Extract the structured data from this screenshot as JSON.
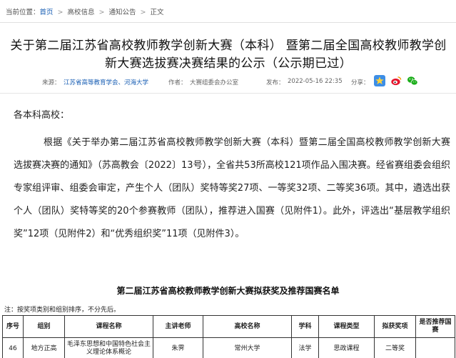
{
  "breadcrumb": {
    "prefix": "当前位置：",
    "items": [
      "首页",
      "高校信息",
      "通知公告",
      "正文"
    ]
  },
  "article": {
    "title": "关于第二届江苏省高校教师教学创新大赛（本科） 暨第二届全国高校教师教学创新大赛选拔赛决赛结果的公示（公示期已过）",
    "meta": {
      "source_label": "来源：",
      "source_value": "江苏省高等教育学会、河海大学",
      "author_label": "作者：",
      "author_value": "大赛组委会办公室",
      "date_label": "发布：",
      "date_value": "2022-05-16 22:35",
      "share_label": "分享："
    },
    "salutation": "各本科高校：",
    "paragraph": "根据《关于举办第二届江苏省高校教师教学创新大赛（本科）暨第二届全国高校教师教学创新大赛选拔赛决赛的通知》（苏高教会〔2022〕13号），全省共53所高校121项作品入围决赛。经省赛组委会组织专家组评审、组委会审定，产生个人（团队）奖特等奖27项、一等奖32项、二等奖36项。其中，遴选出获个人（团队）奖特等奖的20个参赛教师（团队），推荐进入国赛（见附件1）。此外，评选出“基层教学组织奖”12项（见附件2）和“优秀组织奖”11项（见附件3）。"
  },
  "awards_table": {
    "title": "第二届江苏省高校教师教学创新大赛拟获奖及推荐国赛名单",
    "note": "注：按奖项类别和组别排序，不分先后。",
    "headers": [
      "序号",
      "组别",
      "课程名称",
      "主讲老师",
      "高校名称",
      "学科",
      "课程类型",
      "拟获奖项",
      "是否推荐国赛"
    ],
    "rows": [
      [
        "46",
        "地方正高",
        "毛泽东思想和中国特色社会主义理论体系概论",
        "朱霁",
        "常州大学",
        "法学",
        "思政课程",
        "二等奖",
        ""
      ]
    ]
  },
  "share_icons": [
    "qzone-icon",
    "weibo-icon",
    "wechat-icon"
  ],
  "colors": {
    "link": "#1a5fb4",
    "qzone": "#3d8ee6",
    "weibo": "#e6162d",
    "wechat": "#1aad19"
  }
}
